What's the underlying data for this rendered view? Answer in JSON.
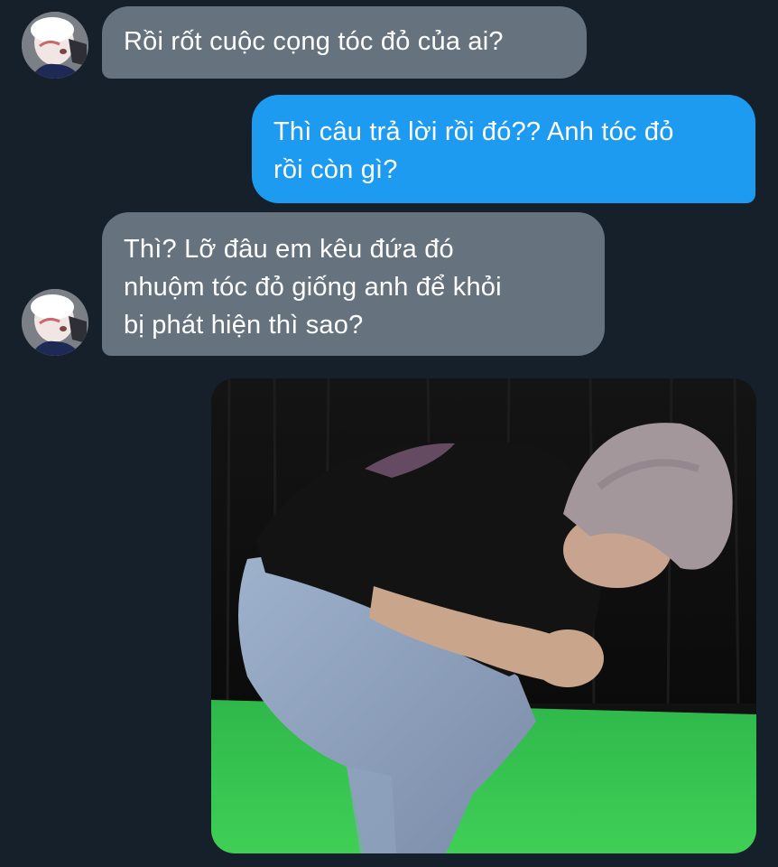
{
  "conversation": {
    "messages": [
      {
        "direction": "incoming",
        "lines": [
          "Rồi rốt cuộc cọng tóc đỏ của ai?"
        ]
      },
      {
        "direction": "outgoing",
        "lines": [
          "Thì câu trả lời rồi đó?? Anh tóc đỏ",
          "rồi còn gì?"
        ]
      },
      {
        "direction": "incoming",
        "lines": [
          "Thì? Lỡ đâu em kêu đứa đó",
          "nhuộm tóc đỏ giống anh để khỏi",
          "bị phát hiện thì sao?"
        ]
      },
      {
        "direction": "outgoing",
        "type": "media",
        "media_description_icon": "photo-icon"
      }
    ]
  },
  "colors": {
    "background": "#15202b",
    "incoming_bubble": "#66737f",
    "outgoing_bubble": "#1d9bf0",
    "text": "#ffffff"
  }
}
